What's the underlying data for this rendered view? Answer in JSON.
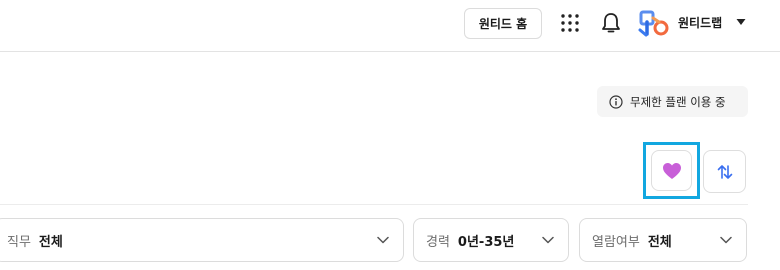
{
  "header": {
    "home_button": "원티드 홈",
    "company_name": "원티드랩",
    "icons": [
      "apps-grid-icon",
      "bell-icon",
      "company-logo",
      "caret-down-icon"
    ]
  },
  "plan_badge": {
    "icon": "info-icon",
    "text": "무제한 플랜 이용 중"
  },
  "actions": {
    "like_icon": "heart-icon",
    "like_color": "#c85fd8",
    "sort_icon": "sort-arrows-icon",
    "highlight_color": "#12a7e0"
  },
  "filters": [
    {
      "label": "직무",
      "value": "전체"
    },
    {
      "label": "경력",
      "value": "0년-35년"
    },
    {
      "label": "열람여부",
      "value": "전체"
    }
  ]
}
